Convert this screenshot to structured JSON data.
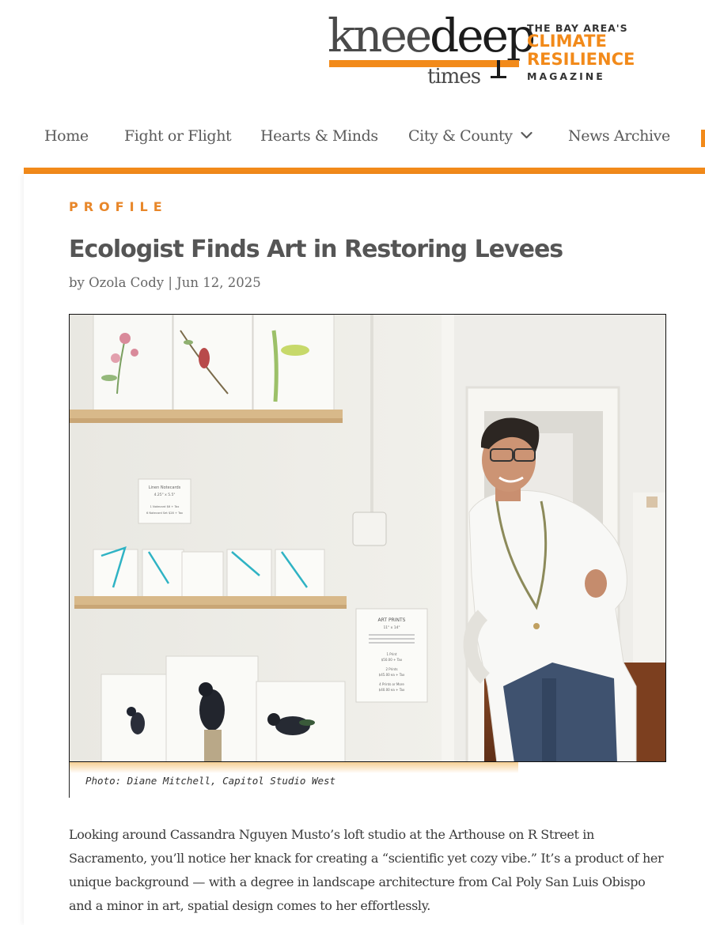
{
  "logo": {
    "word_1": "knee",
    "word_2": "deep",
    "word_3": "times",
    "tagline_1": "THE BAY AREA'S",
    "tagline_2": "CLIMATE",
    "tagline_3": "RESILIENCE",
    "tagline_4": "MAGAZINE",
    "brand_color": "#f28a1a"
  },
  "nav": {
    "items": [
      {
        "label": "Home"
      },
      {
        "label": "Fight or Flight"
      },
      {
        "label": "Hearts & Minds"
      },
      {
        "label": "City & County",
        "has_dropdown": true
      },
      {
        "label": "News Archive"
      }
    ],
    "chevron_icon": "chevron-down-icon"
  },
  "article": {
    "category": "PROFILE",
    "title": "Ecologist Finds Art in Restoring Levees",
    "byline_prefix": "by",
    "author": "Ozola Cody",
    "separator": "|",
    "date": "Jun 12, 2025",
    "photo": {
      "notecard_sign_title": "Linen Notecards",
      "notecard_sign_size": "4.25\" x 5.5\"",
      "notecard_sign_line_1": "1 Notecard $6 + Tax",
      "notecard_sign_line_2": "6 Notecard Set $28 + Tax",
      "prints_sign_title": "ART PRINTS",
      "prints_sign_size": "11\" x 14\"",
      "prints_sign_line_1": "1 Print",
      "prints_sign_line_2": "$50.00 + Tax",
      "prints_sign_line_3": "2 Prints",
      "prints_sign_line_4": "$45.00 ea + Tax",
      "prints_sign_line_5": "4 Prints or More",
      "prints_sign_line_6": "$40.00 ea + Tax"
    },
    "caption": "Photo: Diane Mitchell, Capitol Studio West",
    "body": "Looking around Cassandra Nguyen Musto’s loft studio at the Arthouse on R Street in Sacramento, you’ll notice her knack for creating a “scientific yet cozy vibe.” It’s a product of her unique background — with a degree in landscape architecture from Cal Poly San Luis Obispo and a minor in art, spatial design comes to her effortlessly."
  }
}
